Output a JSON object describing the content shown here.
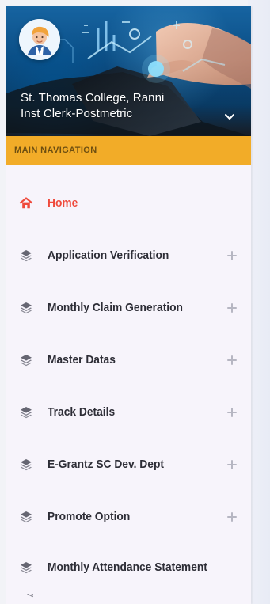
{
  "header": {
    "college_name": "St. Thomas College, Ranni",
    "role_name": "Inst Clerk-Postmetric"
  },
  "navigation": {
    "section_title": "MAIN NAVIGATION",
    "items": [
      {
        "label": "Home",
        "icon": "home-icon",
        "active": true,
        "expandable": false
      },
      {
        "label": "Application Verification",
        "icon": "layers-icon",
        "active": false,
        "expandable": true
      },
      {
        "label": "Monthly Claim Generation",
        "icon": "layers-icon",
        "active": false,
        "expandable": true
      },
      {
        "label": "Master Datas",
        "icon": "layers-icon",
        "active": false,
        "expandable": true
      },
      {
        "label": "Track Details",
        "icon": "layers-icon",
        "active": false,
        "expandable": true
      },
      {
        "label": "E-Grantz SC Dev. Dept",
        "icon": "layers-icon",
        "active": false,
        "expandable": true
      },
      {
        "label": "Promote Option",
        "icon": "layers-icon",
        "active": false,
        "expandable": true
      },
      {
        "label": "Monthly Attendance Statement",
        "icon": "layers-icon",
        "active": false,
        "expandable": false
      }
    ]
  },
  "colors": {
    "accent_bar": "#f2ac28",
    "active_text": "#ef4a3c",
    "menu_text": "#2d2d36",
    "drawer_bg": "#f7f4fb",
    "header_blue": "#0b4c82"
  },
  "icons": {
    "header_toggle": "chevron-down-icon",
    "avatar": "avatar"
  }
}
